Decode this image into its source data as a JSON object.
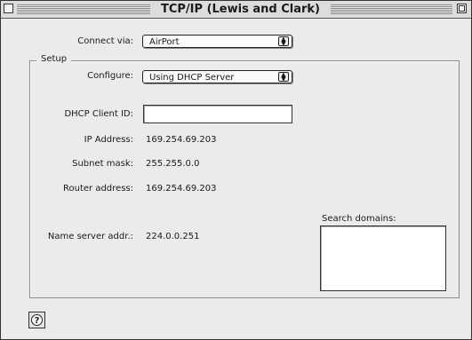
{
  "window": {
    "title": "TCP/IP (Lewis and Clark)"
  },
  "connect_via": {
    "label": "Connect via:",
    "value": "AirPort"
  },
  "setup": {
    "group_label": "Setup",
    "configure": {
      "label": "Configure:",
      "value": "Using DHCP Server"
    },
    "dhcp_client_id": {
      "label": "DHCP Client ID:",
      "value": ""
    },
    "ip_address": {
      "label": "IP Address:",
      "value": "169.254.69.203"
    },
    "subnet_mask": {
      "label": "Subnet mask:",
      "value": "255.255.0.0"
    },
    "router_address": {
      "label": "Router address:",
      "value": "169.254.69.203"
    },
    "name_server": {
      "label": "Name server addr.:",
      "value": "224.0.0.251"
    },
    "search_domains": {
      "label": "Search domains:",
      "value": ""
    }
  },
  "help": {
    "glyph": "?"
  }
}
